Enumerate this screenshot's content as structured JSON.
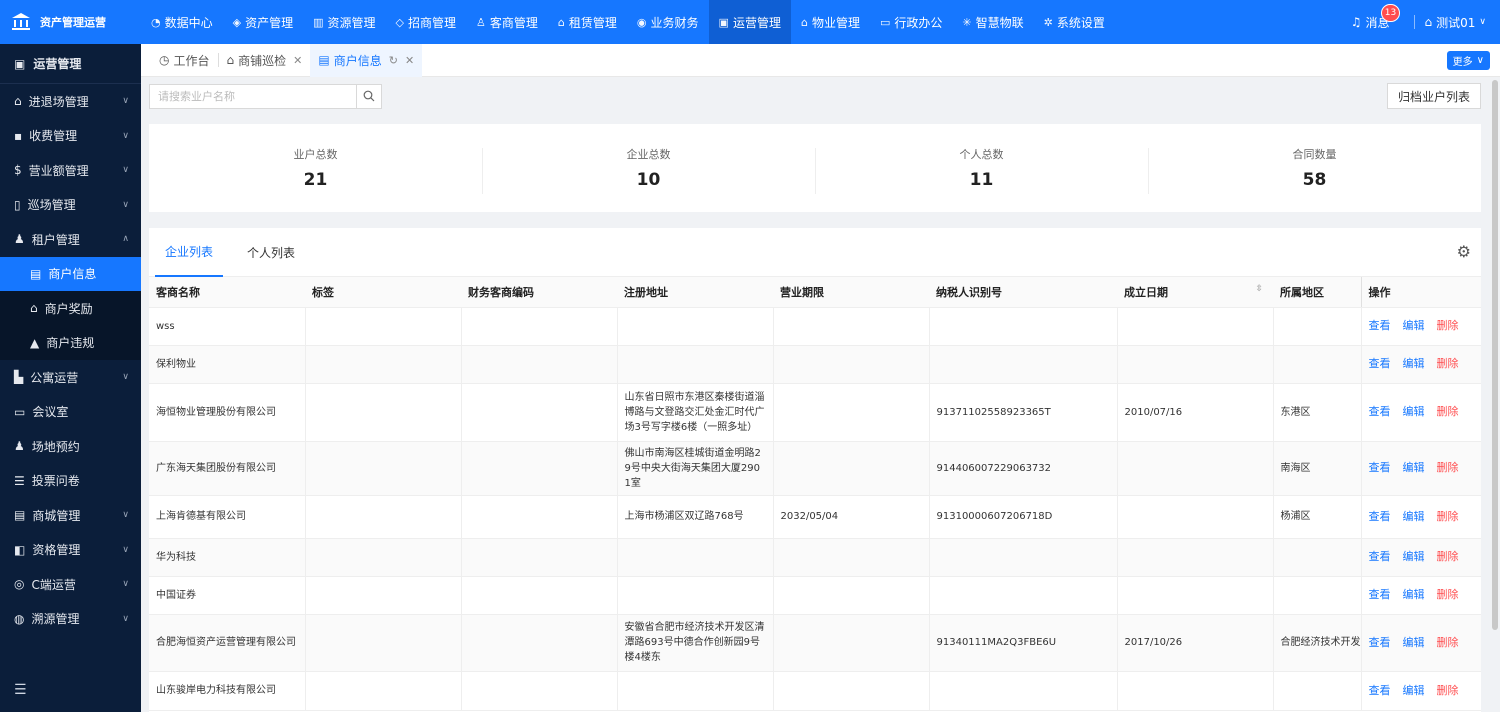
{
  "brand": {
    "title": "资产管理运营"
  },
  "topnav": {
    "items": [
      {
        "label": "数据中心",
        "icon": "dashboard-icon"
      },
      {
        "label": "资产管理",
        "icon": "cube-icon"
      },
      {
        "label": "资源管理",
        "icon": "building-icon"
      },
      {
        "label": "招商管理",
        "icon": "tag-icon"
      },
      {
        "label": "客商管理",
        "icon": "users-icon"
      },
      {
        "label": "租赁管理",
        "icon": "home-icon"
      },
      {
        "label": "业务财务",
        "icon": "finance-icon"
      },
      {
        "label": "运营管理",
        "icon": "operations-icon"
      },
      {
        "label": "物业管理",
        "icon": "property-icon"
      },
      {
        "label": "行政办公",
        "icon": "desktop-icon"
      },
      {
        "label": "智慧物联",
        "icon": "iot-icon"
      },
      {
        "label": "系统设置",
        "icon": "settings-icon"
      }
    ],
    "active_index": 7,
    "messages_label": "消息",
    "messages_count": "13",
    "user_label": "测试01"
  },
  "sidebar": {
    "title": "运营管理",
    "items": [
      {
        "label": "进退场管理",
        "expandable": true
      },
      {
        "label": "收费管理",
        "expandable": true
      },
      {
        "label": "营业额管理",
        "expandable": true
      },
      {
        "label": "巡场管理",
        "expandable": true
      },
      {
        "label": "租户管理",
        "expandable": true,
        "expanded": true
      },
      {
        "label": "公寓运营",
        "expandable": true
      },
      {
        "label": "会议室",
        "expandable": false
      },
      {
        "label": "场地预约",
        "expandable": false
      },
      {
        "label": "投票问卷",
        "expandable": false
      },
      {
        "label": "商城管理",
        "expandable": true
      },
      {
        "label": "资格管理",
        "expandable": true
      },
      {
        "label": "C端运营",
        "expandable": true
      },
      {
        "label": "溯源管理",
        "expandable": true
      }
    ],
    "subitems": [
      {
        "label": "商户信息",
        "active": true
      },
      {
        "label": "商户奖励",
        "active": false
      },
      {
        "label": "商户违规",
        "active": false
      }
    ]
  },
  "tabs": {
    "items": [
      {
        "label": "工作台",
        "closable": false
      },
      {
        "label": "商铺巡检",
        "closable": true
      },
      {
        "label": "商户信息",
        "closable": true,
        "active": true
      }
    ],
    "more_label": "更多"
  },
  "search": {
    "placeholder": "请搜索业户名称"
  },
  "archive_button": "归档业户列表",
  "stats": [
    {
      "label": "业户总数",
      "value": "21"
    },
    {
      "label": "企业总数",
      "value": "10"
    },
    {
      "label": "个人总数",
      "value": "11"
    },
    {
      "label": "合同数量",
      "value": "58"
    }
  ],
  "list": {
    "tabs": [
      "企业列表",
      "个人列表"
    ],
    "columns": [
      "客商名称",
      "标签",
      "财务客商编码",
      "注册地址",
      "营业期限",
      "纳税人识别号",
      "成立日期",
      "所属地区",
      "操作"
    ],
    "actions": {
      "view": "查看",
      "edit": "编辑",
      "delete": "删除"
    },
    "rows": [
      {
        "name": "wss",
        "tag": "",
        "code": "",
        "address": "",
        "term": "",
        "tax_id": "",
        "founded": "",
        "region": ""
      },
      {
        "name": "保利物业",
        "tag": "",
        "code": "",
        "address": "",
        "term": "",
        "tax_id": "",
        "founded": "",
        "region": ""
      },
      {
        "name": "海恒物业管理股份有限公司",
        "tag": "",
        "code": "",
        "address": "山东省日照市东港区秦楼街道淄博路与文登路交汇处金汇时代广场3号写字楼6楼（一照多址）",
        "term": "",
        "tax_id": "91371102558923365T",
        "founded": "2010/07/16",
        "region": "东港区"
      },
      {
        "name": "广东海天集团股份有限公司",
        "tag": "",
        "code": "",
        "address": "佛山市南海区桂城街道金明路29号中央大街海天集团大厦2901室",
        "term": "",
        "tax_id": "914406007229063732",
        "founded": "",
        "region": "南海区"
      },
      {
        "name": "上海肯德基有限公司",
        "tag": "",
        "code": "",
        "address": "上海市杨浦区双辽路768号",
        "term": "2032/05/04",
        "tax_id": "91310000607206718D",
        "founded": "",
        "region": "杨浦区"
      },
      {
        "name": "华为科技",
        "tag": "",
        "code": "",
        "address": "",
        "term": "",
        "tax_id": "",
        "founded": "",
        "region": ""
      },
      {
        "name": "中国证券",
        "tag": "",
        "code": "",
        "address": "",
        "term": "",
        "tax_id": "",
        "founded": "",
        "region": ""
      },
      {
        "name": "合肥海恒资产运营管理有限公司",
        "tag": "",
        "code": "",
        "address": "安徽省合肥市经济技术开发区清潭路693号中德合作创新园9号楼4楼东",
        "term": "",
        "tax_id": "91340111MA2Q3FBE6U",
        "founded": "2017/10/26",
        "region": "合肥经济技术开发区"
      },
      {
        "name": "山东骏岸电力科技有限公司",
        "tag": "",
        "code": "",
        "address": "",
        "term": "",
        "tax_id": "",
        "founded": "",
        "region": ""
      }
    ]
  }
}
